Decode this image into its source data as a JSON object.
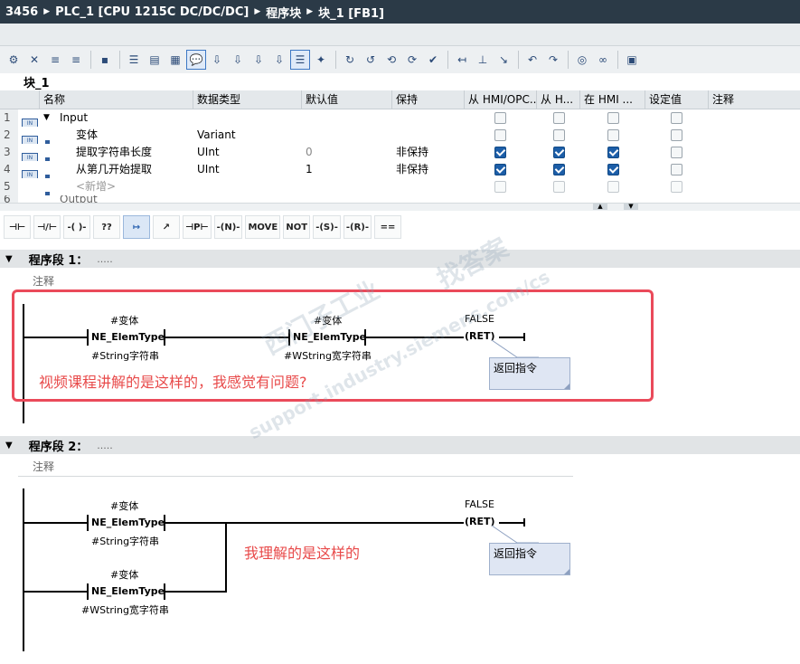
{
  "titlebar": {
    "parts": [
      "3456",
      "PLC_1 [CPU 1215C DC/DC/DC]",
      "程序块",
      "块_1 [FB1]"
    ],
    "sep": "▶"
  },
  "block_title": "块_1",
  "interface": {
    "headers": [
      "名称",
      "数据类型",
      "默认值",
      "保持",
      "从 HMI/OPC...",
      "从 H...",
      "在 HMI ...",
      "设定值",
      "注释"
    ],
    "rows": [
      {
        "num": "1",
        "name": "Input",
        "type": "",
        "default": "",
        "retain": ""
      },
      {
        "num": "2",
        "name": "变体",
        "type": "Variant",
        "default": "",
        "retain": ""
      },
      {
        "num": "3",
        "name": "提取字符串长度",
        "type": "UInt",
        "default": "0",
        "retain": "非保持"
      },
      {
        "num": "4",
        "name": "从第几开始提取",
        "type": "UInt",
        "default": "1",
        "retain": "非保持"
      },
      {
        "num": "5",
        "name": "<新增>",
        "type": "",
        "default": "",
        "retain": ""
      },
      {
        "num": "6",
        "name": "Output",
        "type": "",
        "default": "",
        "retain": ""
      }
    ]
  },
  "ladder_toolbar": [
    "⊣⊢",
    "⊣/⊢",
    "-( )-",
    "??",
    "↦",
    "↗",
    "⊣P⊢",
    "-(N)-",
    "MOVE",
    "NOT",
    "-(S)-",
    "-(R)-",
    "=="
  ],
  "network1": {
    "title": "程序段 1：",
    "dots": ".....",
    "comment": "注释",
    "operand1": "#变体",
    "contact1": "NE_ElemType",
    "type1": "#String字符串",
    "operand2": "#变体",
    "contact2": "NE_ElemType",
    "type2": "#WString宽字符串",
    "ret_value": "FALSE",
    "ret": "RET",
    "callout": "返回指令",
    "annotation": "视频课程讲解的是这样的，我感觉有问题?"
  },
  "network2": {
    "title": "程序段 2：",
    "dots": ".....",
    "comment": "注释",
    "operand1": "#变体",
    "contact1": "NE_ElemType",
    "type1": "#String字符串",
    "operand2": "#变体",
    "contact2": "NE_ElemType",
    "type2": "#WString宽字符串",
    "ret_value": "FALSE",
    "ret": "RET",
    "callout": "返回指令",
    "annotation": "我理解的是这样的"
  },
  "watermark": {
    "line1": "西门子工业",
    "line2": "找答案",
    "line3": "support.industry.siemens.com/cs"
  },
  "colors": {
    "titlebar": "#2b3a47",
    "annotation_red": "#e84a4a",
    "check_blue": "#1c5ea8"
  }
}
